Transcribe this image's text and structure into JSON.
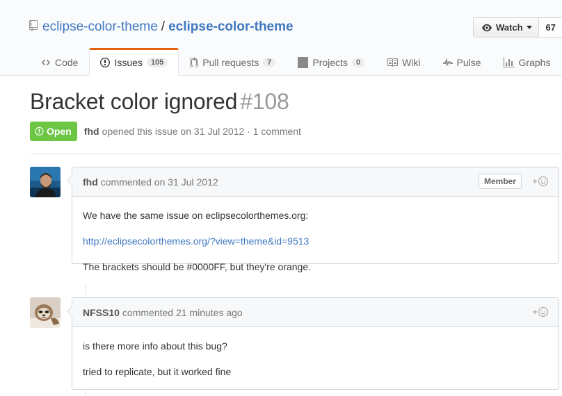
{
  "repo": {
    "owner": "eclipse-color-theme",
    "separator": "/",
    "name": "eclipse-color-theme"
  },
  "watch": {
    "label": "Watch",
    "count": "67"
  },
  "tabs": [
    {
      "label": "Code",
      "icon": "code-icon"
    },
    {
      "label": "Issues",
      "icon": "issue-opened-icon",
      "count": "105",
      "selected": true
    },
    {
      "label": "Pull requests",
      "icon": "git-pull-request-icon",
      "count": "7"
    },
    {
      "label": "Projects",
      "icon": "project-icon",
      "count": "0"
    },
    {
      "label": "Wiki",
      "icon": "book-icon"
    },
    {
      "label": "Pulse",
      "icon": "pulse-icon"
    },
    {
      "label": "Graphs",
      "icon": "graph-icon"
    }
  ],
  "issue": {
    "title": "Bracket color ignored",
    "number": "#108",
    "state": "Open",
    "author": "fhd",
    "meta_text": "opened this issue on 31 Jul 2012 · 1 comment"
  },
  "comments": [
    {
      "author": "fhd",
      "time_text": "commented on 31 Jul 2012",
      "role": "Member",
      "body": [
        "We have the same issue on eclipsecolorthemes.org:",
        "http://eclipsecolorthemes.org/?view=theme&id=9513",
        "The brackets should be #0000FF, but they're orange."
      ]
    },
    {
      "author": "NFSS10",
      "time_text": "commented 21 minutes ago",
      "body": [
        "is there more info about this bug?",
        "tried to replicate, but it worked fine"
      ]
    }
  ],
  "colors": {
    "link": "#4078c0",
    "open_badge": "#6cc644",
    "selected_tab_accent": "#e36209"
  }
}
